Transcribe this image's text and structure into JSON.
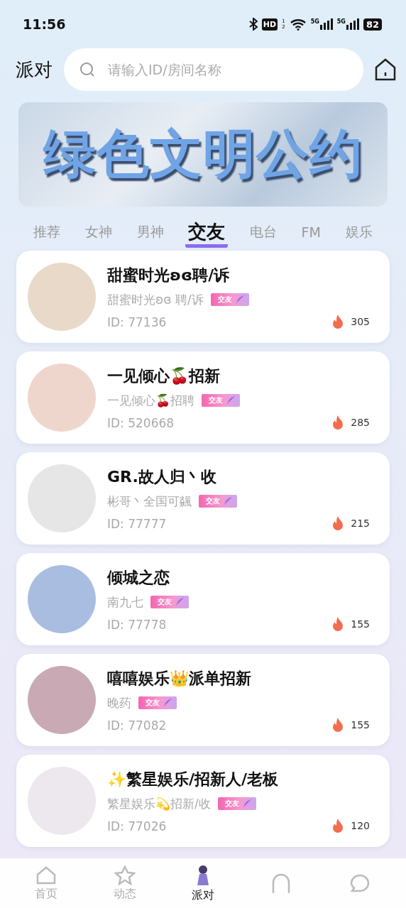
{
  "status_bar": {
    "time": "11:56",
    "hd": "HD",
    "hd_sims": [
      "1",
      "2"
    ],
    "networks": [
      "5G",
      "5G"
    ],
    "battery": "82"
  },
  "header": {
    "title": "派对",
    "search": {
      "placeholder": "请输入ID/房间名称"
    }
  },
  "banner": {
    "text": "绿色文明公约"
  },
  "tabs": [
    {
      "label": "推荐",
      "selected": false
    },
    {
      "label": "女神",
      "selected": false
    },
    {
      "label": "男神",
      "selected": false
    },
    {
      "label": "交友",
      "selected": true
    },
    {
      "label": "电台",
      "selected": false
    },
    {
      "label": "FM",
      "selected": false
    },
    {
      "label": "娱乐",
      "selected": false
    }
  ],
  "rooms": [
    {
      "name": "甜蜜时光ʚɞ聘/诉",
      "host": "甜蜜时光ʚɞ 聘/诉",
      "tag": "交友",
      "id": "ID: 77136",
      "heat": "305",
      "color": "#e8d9c8"
    },
    {
      "name": "一见倾心🍒招新",
      "host": "一见倾心🍒招聘",
      "tag": "交友",
      "id": "ID: 520668",
      "heat": "285",
      "color": "#efd6cc"
    },
    {
      "name": "GR.故人归丶收",
      "host": "彬哥丶全国可飊",
      "tag": "交友",
      "id": "ID: 77777",
      "heat": "215",
      "color": "#e6e6e6"
    },
    {
      "name": "倾城之恋",
      "host": "南九七",
      "tag": "交友",
      "id": "ID: 77778",
      "heat": "155",
      "color": "#a9bde0"
    },
    {
      "name": "嘻嘻娱乐👑派单招新",
      "host": "晚药",
      "tag": "交友",
      "id": "ID: 77082",
      "heat": "155",
      "color": "#c9a9b4"
    },
    {
      "name": "✨繁星娱乐/招新人/老板",
      "host": "繁星娱乐💫招新/收",
      "tag": "交友",
      "id": "ID: 77026",
      "heat": "120",
      "color": "#ece8ee"
    }
  ],
  "nav": [
    {
      "kind": "home",
      "label": "首页",
      "selected": false
    },
    {
      "kind": "moments",
      "label": "动态",
      "selected": false
    },
    {
      "kind": "party",
      "label": "派对",
      "selected": true
    },
    {
      "kind": "circle"
    },
    {
      "kind": "chat"
    }
  ]
}
